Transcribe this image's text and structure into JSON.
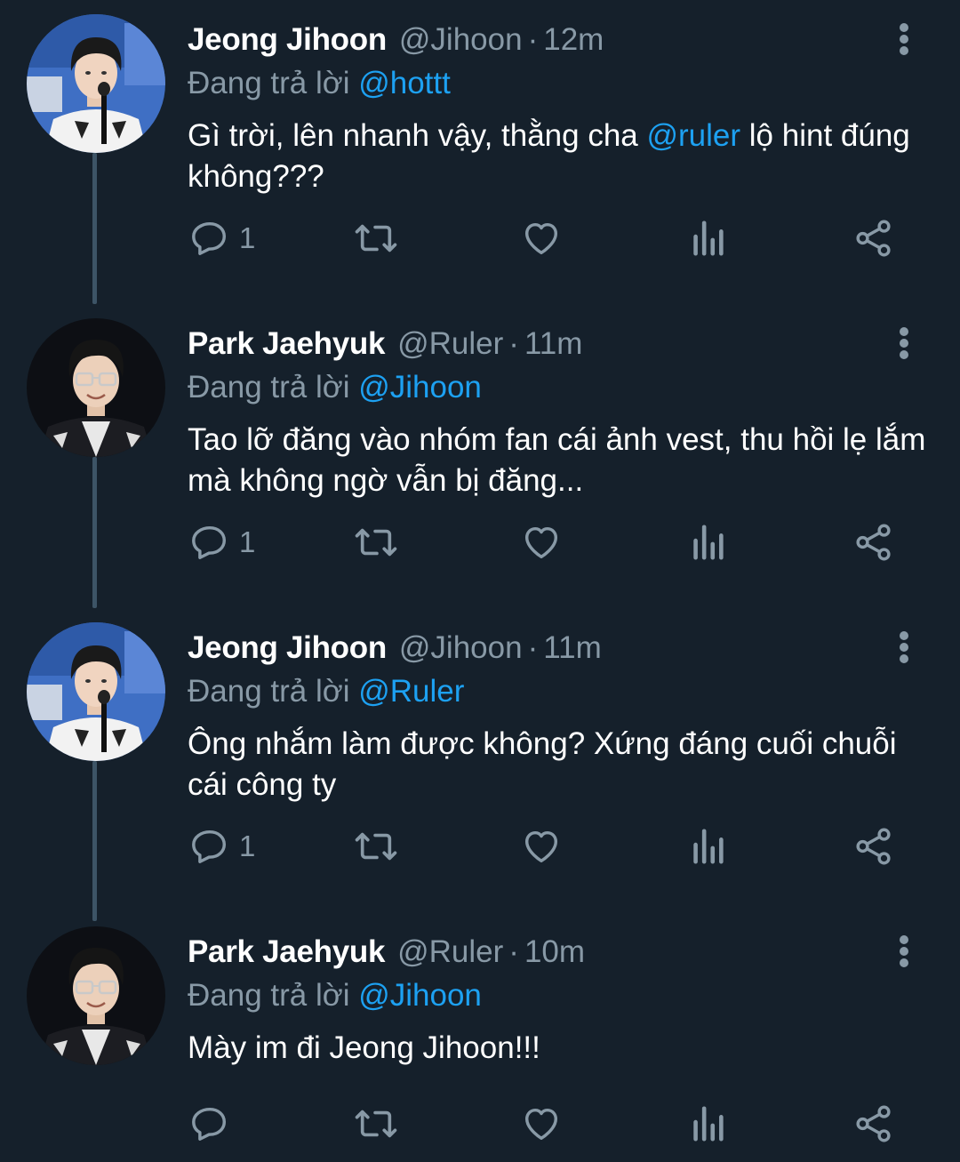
{
  "colors": {
    "background": "#15202b",
    "secondary_text": "#8899a6",
    "mention": "#1da1f2",
    "thread_line": "#3d5466",
    "icon": "#8899a6"
  },
  "icons": {
    "reply": "reply-icon",
    "retweet": "retweet-icon",
    "like": "heart-icon",
    "analytics": "analytics-icon",
    "share": "share-icon",
    "more": "more-vertical-icon"
  },
  "tweets": [
    {
      "name": "Jeong Jihoon",
      "handle": "@Jihoon",
      "separator": "·",
      "time": "12m",
      "reply_prefix": "Đang trả lời",
      "reply_to": "@hottt",
      "text_before": "Gì trời, lên nhanh vậy, thằng cha ",
      "text_mention": "@ruler",
      "text_after": " lộ hint đúng không???",
      "reply_count": "1"
    },
    {
      "name": "Park Jaehyuk",
      "handle": "@Ruler",
      "separator": "·",
      "time": "11m",
      "reply_prefix": "Đang trả lời",
      "reply_to": "@Jihoon",
      "text_before": "Tao lỡ đăng vào nhóm fan cái ảnh vest, thu hồi lẹ lắm mà không ngờ vẫn bị đăng...",
      "text_mention": "",
      "text_after": "",
      "reply_count": "1"
    },
    {
      "name": "Jeong Jihoon",
      "handle": "@Jihoon",
      "separator": "·",
      "time": "11m",
      "reply_prefix": "Đang trả lời",
      "reply_to": "@Ruler",
      "text_before": "Ông nhắm làm được không? Xứng đáng cuối chuỗi cái công ty",
      "text_mention": "",
      "text_after": "",
      "reply_count": "1"
    },
    {
      "name": "Park Jaehyuk",
      "handle": "@Ruler",
      "separator": "·",
      "time": "10m",
      "reply_prefix": "Đang trả lời",
      "reply_to": "@Jihoon",
      "text_before": "Mày im đi Jeong Jihoon!!!",
      "text_mention": "",
      "text_after": "",
      "reply_count": ""
    }
  ]
}
